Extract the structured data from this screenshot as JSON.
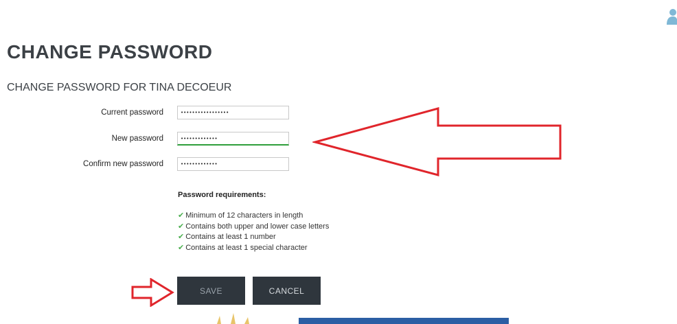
{
  "header": {
    "title": "CHANGE PASSWORD",
    "subtitle": "CHANGE PASSWORD FOR TINA DECOEUR"
  },
  "form": {
    "current_password": {
      "label": "Current password",
      "value": "•••••••••••••••••"
    },
    "new_password": {
      "label": "New password",
      "value": "•••••••••••••"
    },
    "confirm_password": {
      "label": "Confirm new password",
      "value": "•••••••••••••"
    }
  },
  "requirements": {
    "title": "Password requirements:",
    "items": [
      "Minimum of 12 characters in length",
      "Contains both upper and lower case letters",
      "Contains at least 1 number",
      "Contains at least 1 special character"
    ]
  },
  "actions": {
    "save_label": "SAVE",
    "cancel_label": "CANCEL"
  },
  "colors": {
    "check": "#4caf50",
    "annotation_arrow": "#e0252b",
    "button_bg": "#2f363d",
    "input_focus": "#2e9e3a"
  },
  "icons": {
    "user": "user-icon",
    "check": "check-icon"
  }
}
